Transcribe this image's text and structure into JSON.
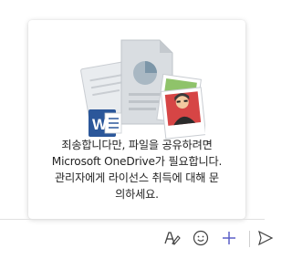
{
  "popup": {
    "message": "죄송합니다만, 파일을 공유하려면\nMicrosoft OneDrive가 필요합니다.\n관리자에게 라이선스 취득에 대해 문\n의하세요.",
    "illustration_icon": "documents-illustration"
  },
  "toolbar": {
    "format_icon": "format-pen-icon",
    "emoji_icon": "emoji-icon",
    "add_icon": "add-icon",
    "send_icon": "send-icon"
  },
  "colors": {
    "accent": "#5b5fc7",
    "word_blue": "#2b579a",
    "text": "#242424",
    "icon": "#424242"
  }
}
